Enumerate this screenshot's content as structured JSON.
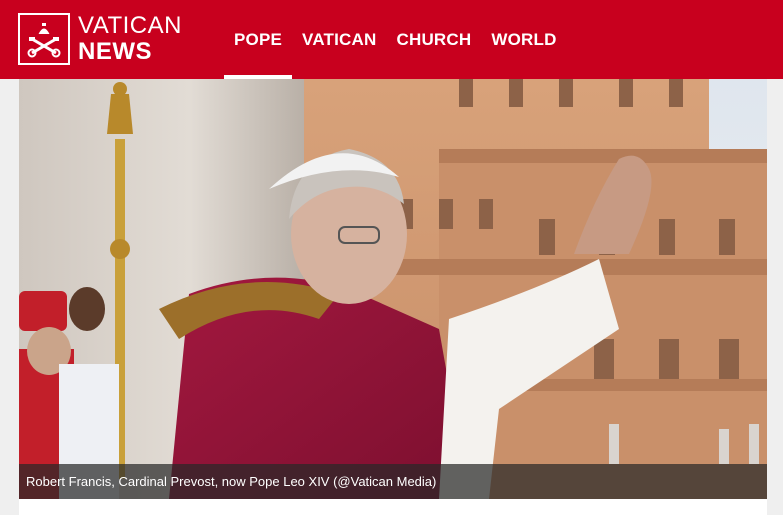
{
  "brand": {
    "line1": "VATICAN",
    "line2": "NEWS",
    "logo_icon": "papal-keys-emblem-icon",
    "color": "#c8001e"
  },
  "nav": {
    "items": [
      {
        "label": "POPE",
        "active": true
      },
      {
        "label": "VATICAN",
        "active": false
      },
      {
        "label": "CHURCH",
        "active": false
      },
      {
        "label": "WORLD",
        "active": false
      }
    ]
  },
  "hero": {
    "caption": "Robert Francis, Cardinal Prevost, now Pope Leo XIV  (@Vatican Media)"
  }
}
